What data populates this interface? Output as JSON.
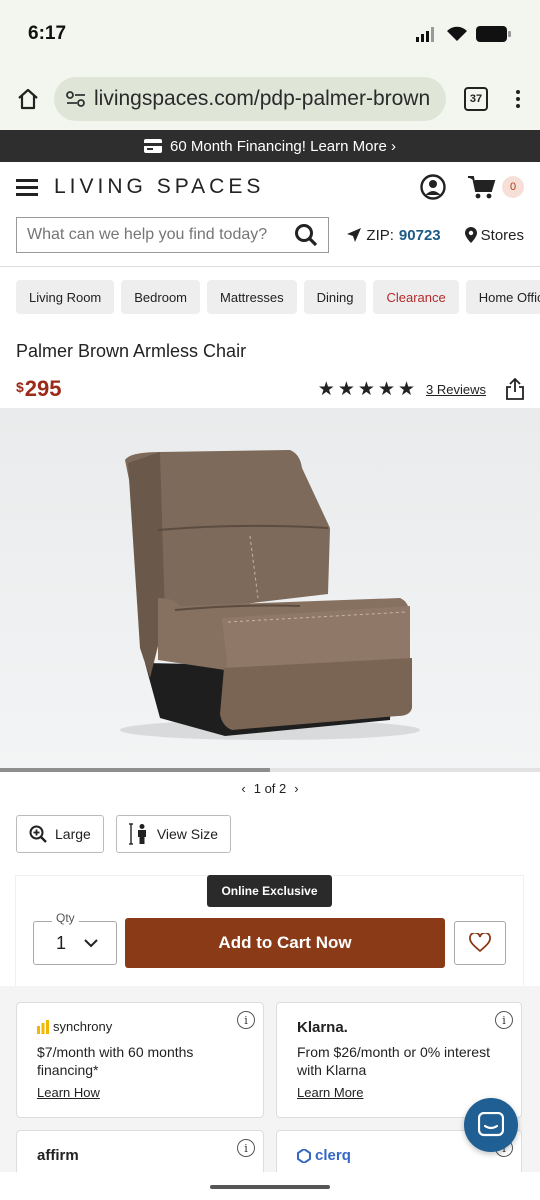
{
  "status": {
    "time": "6:17"
  },
  "browser": {
    "url": "livingspaces.com/pdp-palmer-brown",
    "tab_count": "37"
  },
  "promo": {
    "text": "60 Month Financing! Learn More ›"
  },
  "header": {
    "logo": "LIVING SPACES",
    "cart_count": "0"
  },
  "search": {
    "placeholder": "What can we help you find today?",
    "zip_label": "ZIP:",
    "zip_code": "90723",
    "stores_label": "Stores"
  },
  "categories": [
    "Living Room",
    "Bedroom",
    "Mattresses",
    "Dining",
    "Clearance",
    "Home Office"
  ],
  "product": {
    "title": "Palmer Brown Armless Chair",
    "currency": "$",
    "price": "295",
    "rating": 5,
    "reviews": "3 Reviews"
  },
  "gallery": {
    "pager": "1 of 2",
    "current": 1,
    "total": 2
  },
  "view": {
    "large_label": "Large",
    "size_label": "View Size"
  },
  "purchase": {
    "badge": "Online Exclusive",
    "qty_label": "Qty",
    "qty_value": "1",
    "add_to_cart": "Add to Cart Now"
  },
  "financing": [
    {
      "brand": "synchrony",
      "desc": "$7/month with 60 months financing*",
      "link": "Learn How"
    },
    {
      "brand": "Klarna.",
      "desc": "From $26/month or 0% interest with Klarna",
      "link": "Learn More"
    },
    {
      "brand": "affirm",
      "desc": "",
      "link": ""
    },
    {
      "brand": "clerq",
      "desc": "",
      "link": ""
    }
  ],
  "colors": {
    "accent": "#8b3a18",
    "price": "#9b2a18",
    "zip": "#1c5a86",
    "chat": "#1f5f93"
  }
}
